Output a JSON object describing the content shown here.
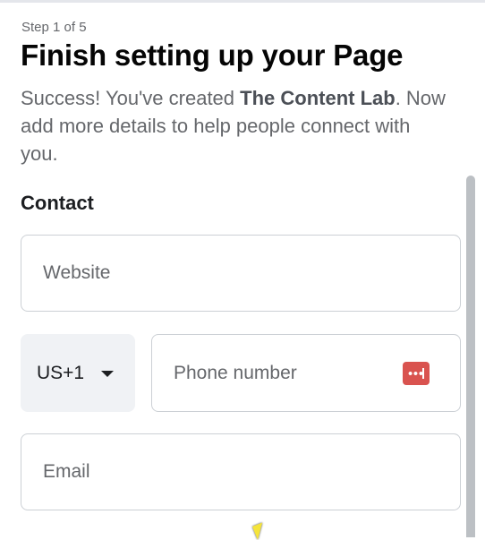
{
  "header": {
    "step": "Step 1 of 5",
    "title": "Finish setting up your Page",
    "desc_prefix": "Success! You've created ",
    "page_name": "The Content Lab",
    "desc_suffix": ". Now add more details to help people connect with you."
  },
  "contact": {
    "section_label": "Contact",
    "website_placeholder": "Website",
    "country_code": "US+1",
    "phone_placeholder": "Phone number",
    "email_placeholder": "Email"
  },
  "icons": {
    "caret": "chevron-down-icon",
    "password_manager": "password-manager-icon",
    "cursor": "mouse-cursor-icon"
  },
  "colors": {
    "title": "#050505",
    "muted_text": "#65676b",
    "field_border": "#ccd0d5",
    "country_bg": "#f0f2f5",
    "password_icon": "#d9534f",
    "scrollbar": "#bcc0c4"
  }
}
